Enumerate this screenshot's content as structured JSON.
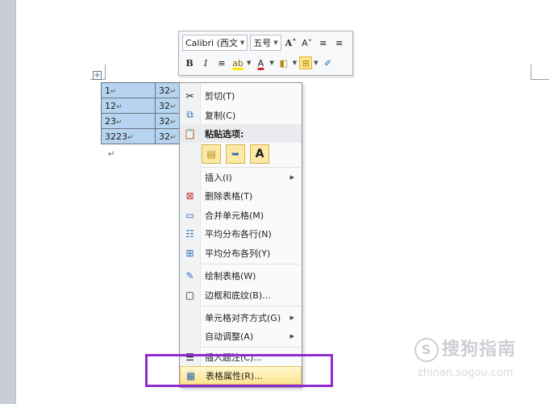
{
  "toolbar": {
    "font_name": "Calibri (西文",
    "font_size": "五号",
    "row1_buttons": [
      {
        "name": "grow-font-icon",
        "glyph": "A˄"
      },
      {
        "name": "shrink-font-icon",
        "glyph": "A˅"
      },
      {
        "name": "decrease-indent-icon",
        "glyph": "≡"
      },
      {
        "name": "increase-indent-icon",
        "glyph": "≡"
      }
    ],
    "bold": "B",
    "italic": "I",
    "center": "≡",
    "highlight": "ab",
    "font_color": "A",
    "shading": "◧",
    "borders": "⊞",
    "format_painter": "✐"
  },
  "table": {
    "rows": [
      [
        "1",
        "32"
      ],
      [
        "12",
        "32"
      ],
      [
        "23",
        "32"
      ],
      [
        "3223",
        "32"
      ]
    ],
    "cell_mark": "↵",
    "para_mark": "↵",
    "anchor": "✛"
  },
  "context_menu": {
    "cut": "剪切(T)",
    "copy": "复制(C)",
    "paste_options": "粘贴选项:",
    "paste_a": "A",
    "insert": "插入(I)",
    "delete_table": "删除表格(T)",
    "merge_cells": "合并单元格(M)",
    "distribute_rows": "平均分布各行(N)",
    "distribute_cols": "平均分布各列(Y)",
    "draw_table": "绘制表格(W)",
    "borders_shading": "边框和底纹(B)...",
    "cell_alignment": "单元格对齐方式(G)",
    "autofit": "自动调整(A)",
    "insert_caption": "插入题注(C)...",
    "table_properties": "表格属性(R)..."
  },
  "watermark": {
    "logo": "S",
    "brand": "搜狗指南",
    "url": "zhinan.sogou.com"
  },
  "colors": {
    "selection": "#b6d4ef",
    "highlight_box": "#8e2bd0",
    "menu_hover": "#fde58f"
  }
}
